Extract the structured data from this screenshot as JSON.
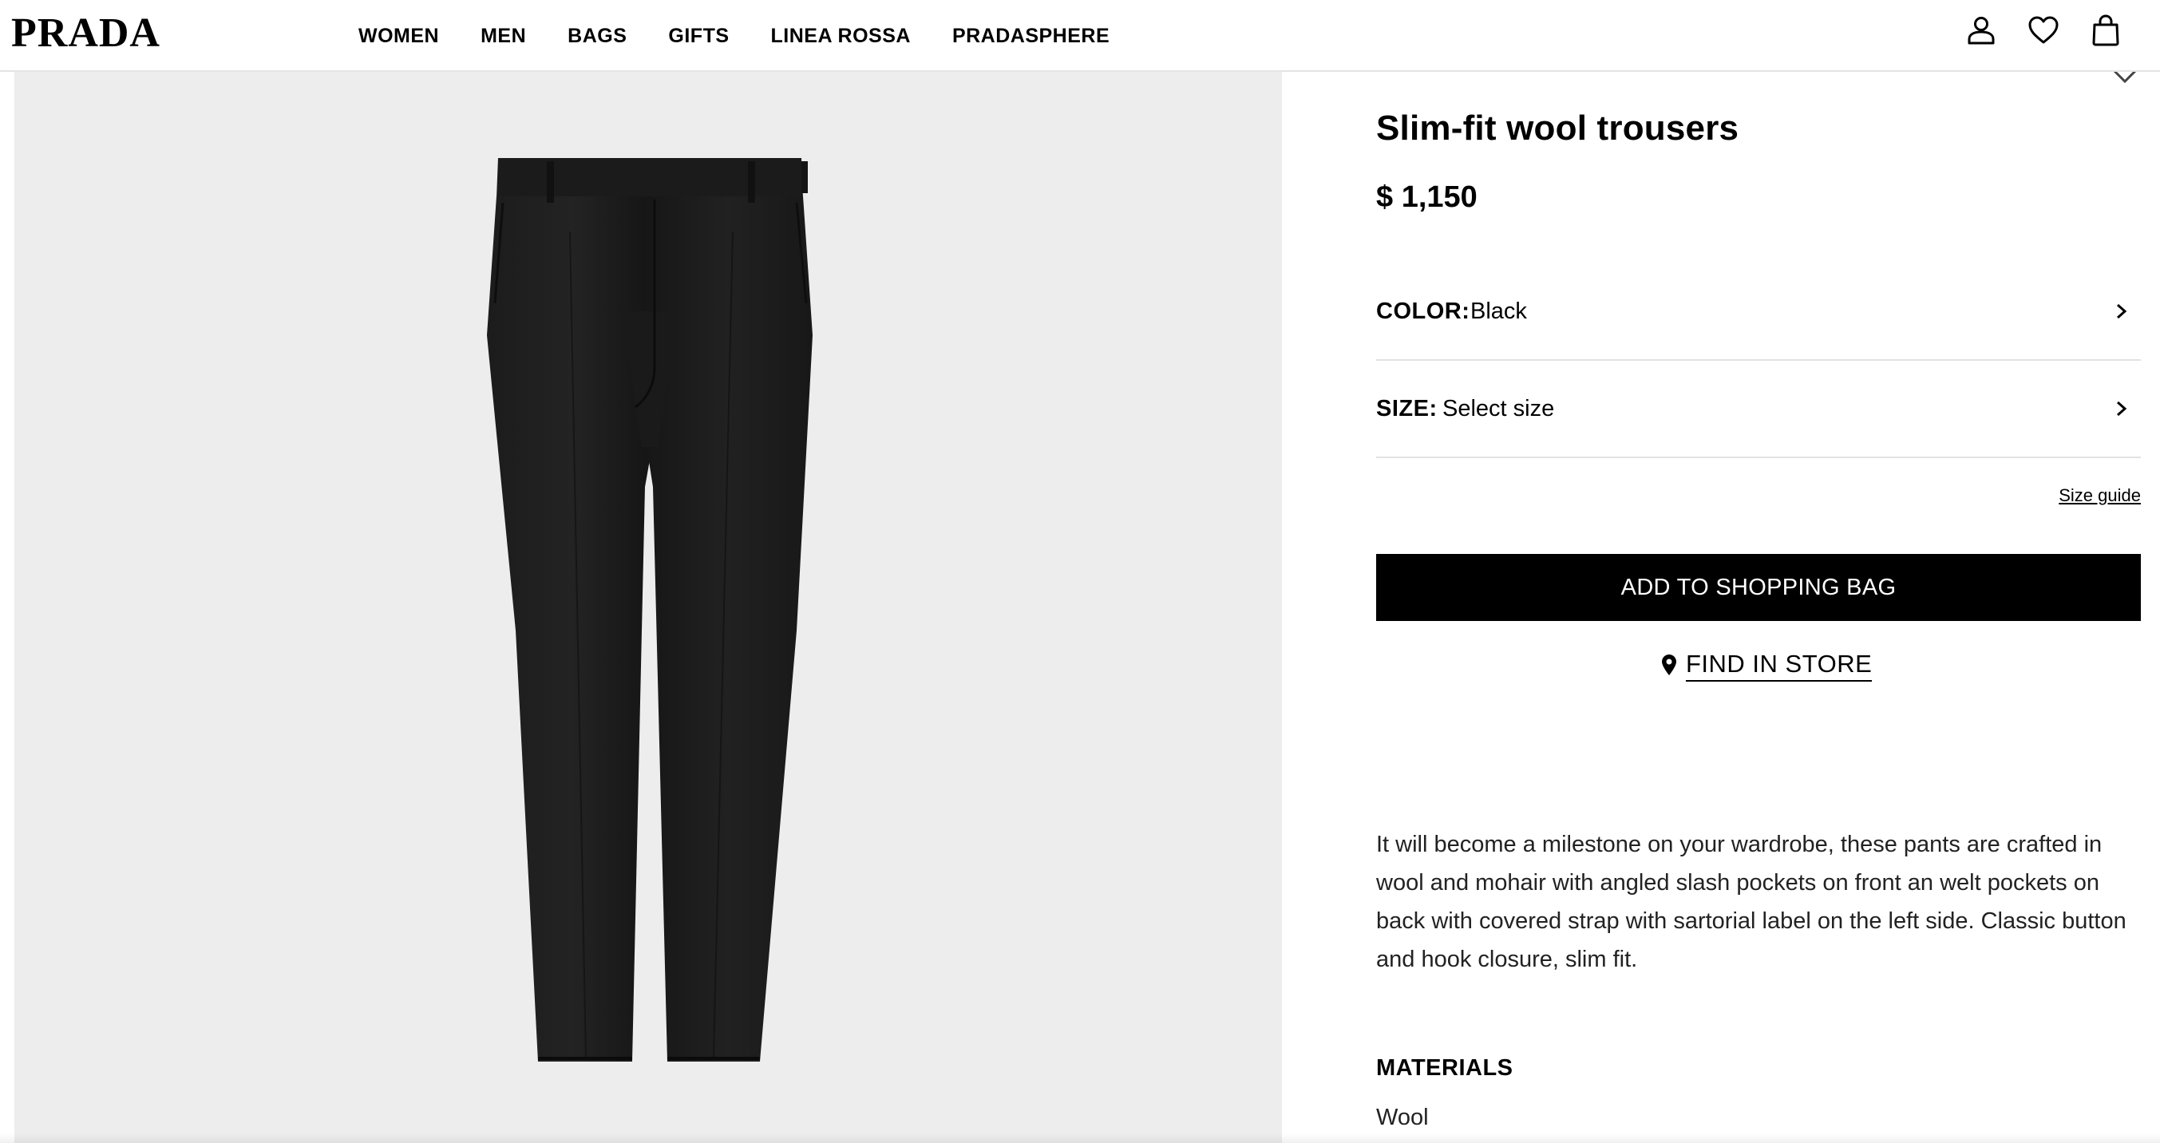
{
  "header": {
    "logo": "PRADA",
    "nav": [
      "WOMEN",
      "MEN",
      "BAGS",
      "GIFTS",
      "LINEA ROSSA",
      "PRADASPHERE"
    ],
    "icons": [
      "account-icon",
      "wishlist-heart-icon",
      "shopping-bag-icon"
    ]
  },
  "product": {
    "title": "Slim-fit wool trousers",
    "price": "$ 1,150",
    "color_label": "COLOR:",
    "color_value": "Black",
    "size_label": "SIZE:",
    "size_value": "Select size",
    "size_guide": "Size guide",
    "add_to_bag": "ADD TO SHOPPING BAG",
    "find_in_store": "FIND IN STORE",
    "description": "It will become a milestone on your wardrobe, these pants are crafted in wool and mohair with angled slash pockets on front an welt pockets on back with covered strap with sartorial label on the left side. Classic button and hook closure, slim fit.",
    "materials_title": "MATERIALS",
    "materials_value": "Wool"
  },
  "colors": {
    "image_background": "#ededee",
    "trousers": "#1a1a1a",
    "button_bg": "#000000",
    "divider": "#e2e2e2"
  }
}
